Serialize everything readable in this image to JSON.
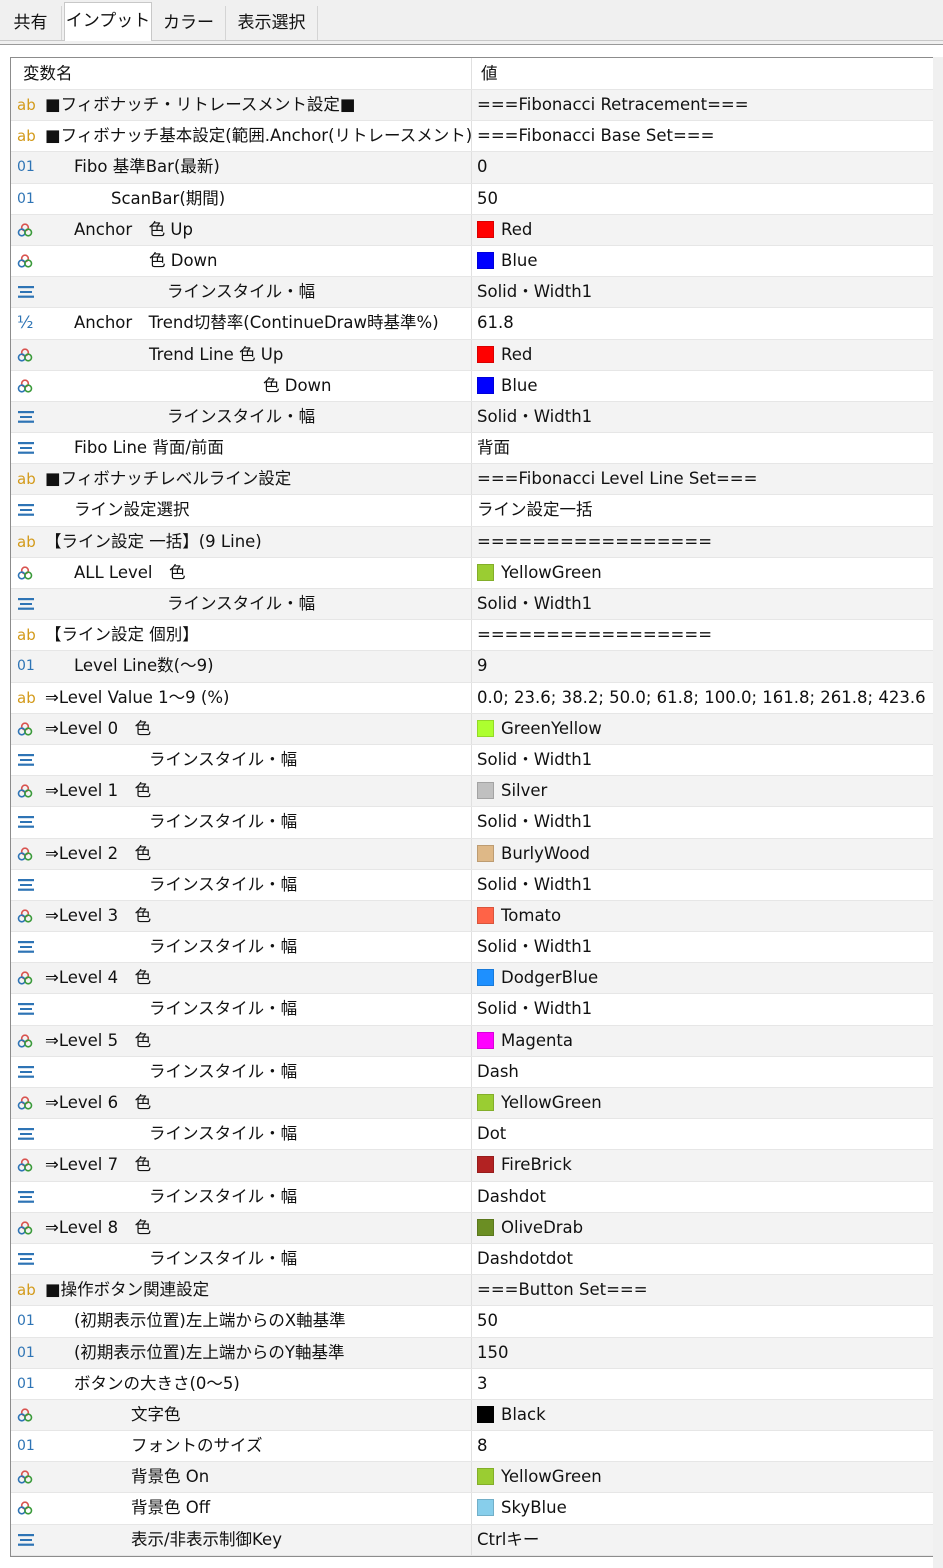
{
  "tabs": [
    {
      "label": "共有",
      "active": false
    },
    {
      "label": "インプット",
      "active": true
    },
    {
      "label": "カラー",
      "active": false
    },
    {
      "label": "表示選択",
      "active": false
    }
  ],
  "header": {
    "name": "変数名",
    "value": "値"
  },
  "rows": [
    {
      "type": "ab",
      "indent": 0,
      "name": "■フィボナッチ・リトレースメント設定■",
      "value": "===Fibonacci Retracement==="
    },
    {
      "type": "ab",
      "indent": 0,
      "name": "■フィボナッチ基本設定(範囲.Anchor(リトレースメント))",
      "value": "===Fibonacci Base Set==="
    },
    {
      "type": "num",
      "indent": 1,
      "name": "Fibo 基準Bar(最新)",
      "value": "0"
    },
    {
      "type": "num",
      "indent": 2,
      "name": "ScanBar(期間)",
      "value": "50"
    },
    {
      "type": "color",
      "indent": 1,
      "name": "Anchor　色 Up",
      "value": "Red",
      "swatch": "#ff0000"
    },
    {
      "type": "color",
      "indent": 3,
      "name": "色 Down",
      "value": "Blue",
      "swatch": "#0000ff"
    },
    {
      "type": "enum",
      "indent": 4,
      "name": "ラインスタイル・幅",
      "value": "Solid・Width1"
    },
    {
      "type": "half",
      "indent": 1,
      "name": "Anchor　Trend切替率(ContinueDraw時基準%)",
      "value": "61.8"
    },
    {
      "type": "color",
      "indent": 3,
      "name": "Trend Line 色 Up",
      "value": "Red",
      "swatch": "#ff0000"
    },
    {
      "type": "color",
      "indent": 6,
      "name": "色 Down",
      "value": "Blue",
      "swatch": "#0000ff"
    },
    {
      "type": "enum",
      "indent": 4,
      "name": "ラインスタイル・幅",
      "value": "Solid・Width1"
    },
    {
      "type": "enum",
      "indent": 1,
      "name": "Fibo Line 背面/前面",
      "value": "背面"
    },
    {
      "type": "ab",
      "indent": 0,
      "name": "■フィボナッチレベルライン設定",
      "value": " ===Fibonacci Level Line Set==="
    },
    {
      "type": "enum",
      "indent": 1,
      "name": "ライン設定選択",
      "value": "ライン設定一括"
    },
    {
      "type": "ab",
      "indent": 0,
      "name": "【ライン設定 一括】(9 Line)",
      "value": "================="
    },
    {
      "type": "color",
      "indent": 1,
      "name": "ALL Level　色",
      "value": "YellowGreen",
      "swatch": "#9acd32"
    },
    {
      "type": "enum",
      "indent": 4,
      "name": "ラインスタイル・幅",
      "value": "Solid・Width1"
    },
    {
      "type": "ab",
      "indent": 0,
      "name": "【ライン設定 個別】",
      "value": "================="
    },
    {
      "type": "num",
      "indent": 1,
      "name": "Level Line数(～9)",
      "value": "9"
    },
    {
      "type": "ab",
      "indent": 0,
      "name": "⇒Level Value 1～9 (%)",
      "value": "0.0; 23.6; 38.2; 50.0; 61.8; 100.0; 161.8; 261.8; 423.6"
    },
    {
      "type": "color",
      "indent": 0,
      "name": "⇒Level 0　色",
      "value": "GreenYellow",
      "swatch": "#adff2f"
    },
    {
      "type": "enum",
      "indent": 3,
      "name": "ラインスタイル・幅",
      "value": "Solid・Width1"
    },
    {
      "type": "color",
      "indent": 0,
      "name": "⇒Level 1　色",
      "value": "Silver",
      "swatch": "#c0c0c0"
    },
    {
      "type": "enum",
      "indent": 3,
      "name": "ラインスタイル・幅",
      "value": "Solid・Width1"
    },
    {
      "type": "color",
      "indent": 0,
      "name": "⇒Level 2　色",
      "value": "BurlyWood",
      "swatch": "#deb887"
    },
    {
      "type": "enum",
      "indent": 3,
      "name": "ラインスタイル・幅",
      "value": "Solid・Width1"
    },
    {
      "type": "color",
      "indent": 0,
      "name": "⇒Level 3　色",
      "value": "Tomato",
      "swatch": "#ff6347"
    },
    {
      "type": "enum",
      "indent": 3,
      "name": "ラインスタイル・幅",
      "value": "Solid・Width1"
    },
    {
      "type": "color",
      "indent": 0,
      "name": "⇒Level 4　色",
      "value": "DodgerBlue",
      "swatch": "#1e90ff"
    },
    {
      "type": "enum",
      "indent": 3,
      "name": "ラインスタイル・幅",
      "value": "Solid・Width1"
    },
    {
      "type": "color",
      "indent": 0,
      "name": "⇒Level 5　色",
      "value": "Magenta",
      "swatch": "#ff00ff"
    },
    {
      "type": "enum",
      "indent": 3,
      "name": "ラインスタイル・幅",
      "value": "Dash"
    },
    {
      "type": "color",
      "indent": 0,
      "name": "⇒Level 6　色",
      "value": "YellowGreen",
      "swatch": "#9acd32"
    },
    {
      "type": "enum",
      "indent": 3,
      "name": "ラインスタイル・幅",
      "value": "Dot"
    },
    {
      "type": "color",
      "indent": 0,
      "name": "⇒Level 7　色",
      "value": "FireBrick",
      "swatch": "#b22222"
    },
    {
      "type": "enum",
      "indent": 3,
      "name": "ラインスタイル・幅",
      "value": "Dashdot"
    },
    {
      "type": "color",
      "indent": 0,
      "name": "⇒Level 8　色",
      "value": "OliveDrab",
      "swatch": "#6b8e23"
    },
    {
      "type": "enum",
      "indent": 3,
      "name": "ラインスタイル・幅",
      "value": "Dashdotdot"
    },
    {
      "type": "ab",
      "indent": 0,
      "name": "■操作ボタン関連設定",
      "value": "===Button Set==="
    },
    {
      "type": "num",
      "indent": 1,
      "name": "(初期表示位置)左上端からのX軸基準",
      "value": "50"
    },
    {
      "type": "num",
      "indent": 1,
      "name": "(初期表示位置)左上端からのY軸基準",
      "value": "150"
    },
    {
      "type": "num",
      "indent": 1,
      "name": "ボタンの大きさ(0～5)",
      "value": "3"
    },
    {
      "type": "color",
      "indent": 5,
      "name": "文字色",
      "value": "Black",
      "swatch": "#000000"
    },
    {
      "type": "num",
      "indent": 5,
      "name": "フォントのサイズ",
      "value": "8"
    },
    {
      "type": "color",
      "indent": 5,
      "name": "背景色 On",
      "value": "YellowGreen",
      "swatch": "#9acd32"
    },
    {
      "type": "color",
      "indent": 5,
      "name": "背景色 Off",
      "value": "SkyBlue",
      "swatch": "#87ceeb"
    },
    {
      "type": "enum",
      "indent": 5,
      "name": "表示/非表示制御Key",
      "value": "Ctrlキー"
    }
  ],
  "icons": {
    "ab": "ab",
    "num": "01",
    "half": "½"
  }
}
